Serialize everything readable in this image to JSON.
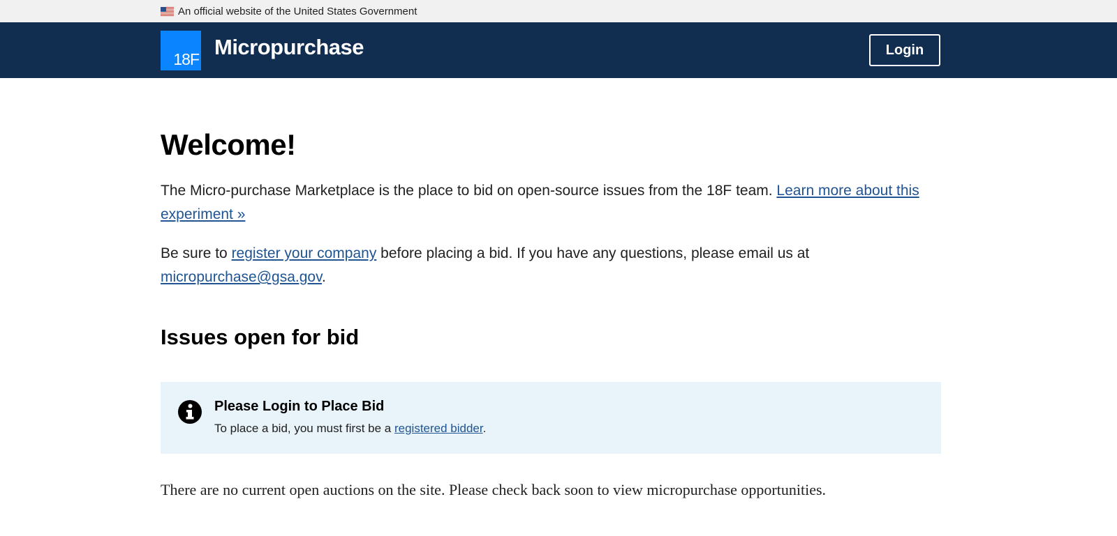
{
  "gov_banner": {
    "text": "An official website of the United States Government",
    "flag_icon": "us-flag-icon"
  },
  "header": {
    "logo_text": "18F",
    "title": "Micropurchase",
    "login_label": "Login",
    "colors": {
      "background": "#112e51",
      "logo": "#0a84ff"
    }
  },
  "main": {
    "heading": "Welcome!",
    "intro": {
      "text": "The Micro-purchase Marketplace is the place to bid on open-source issues from the 18F team. ",
      "link": "Learn more about this experiment »"
    },
    "register": {
      "prefix": "Be sure to ",
      "link": "register your company",
      "middle": " before placing a bid. If you have any questions, please email us at ",
      "email": "micropurchase@gsa.gov",
      "suffix": "."
    },
    "section_heading": "Issues open for bid",
    "alert": {
      "icon": "info-icon",
      "title": "Please Login to Place Bid",
      "body_prefix": "To place a bid, you must first be a ",
      "body_link": "registered bidder",
      "body_suffix": ".",
      "background": "#e8f4fa"
    },
    "no_auctions": "There are no current open auctions on the site. Please check back soon to view micropurchase opportunities."
  }
}
